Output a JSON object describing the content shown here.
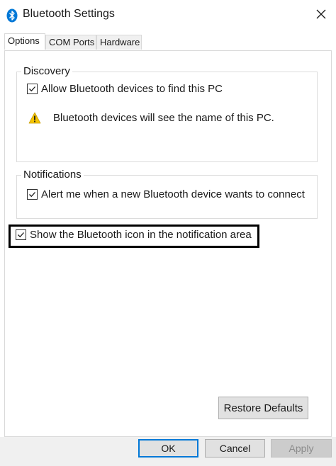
{
  "window": {
    "title": "Bluetooth Settings"
  },
  "tabs": [
    {
      "label": "Options",
      "active": true
    },
    {
      "label": "COM Ports",
      "active": false
    },
    {
      "label": "Hardware",
      "active": false
    }
  ],
  "discovery": {
    "legend": "Discovery",
    "allow_find_label": "Allow Bluetooth devices to find this PC",
    "allow_find_checked": true,
    "warning_text": "Bluetooth devices will see the name of this PC."
  },
  "notifications": {
    "legend": "Notifications",
    "alert_label": "Alert me when a new Bluetooth device wants to connect",
    "alert_checked": true
  },
  "show_icon": {
    "label": "Show the Bluetooth icon in the notification area",
    "checked": true
  },
  "buttons": {
    "restore_defaults": "Restore Defaults",
    "ok": "OK",
    "cancel": "Cancel",
    "apply": "Apply"
  },
  "colors": {
    "bluetooth_icon": "#0078d7",
    "warning": "#f5c400",
    "focus_border": "#0078d7"
  }
}
